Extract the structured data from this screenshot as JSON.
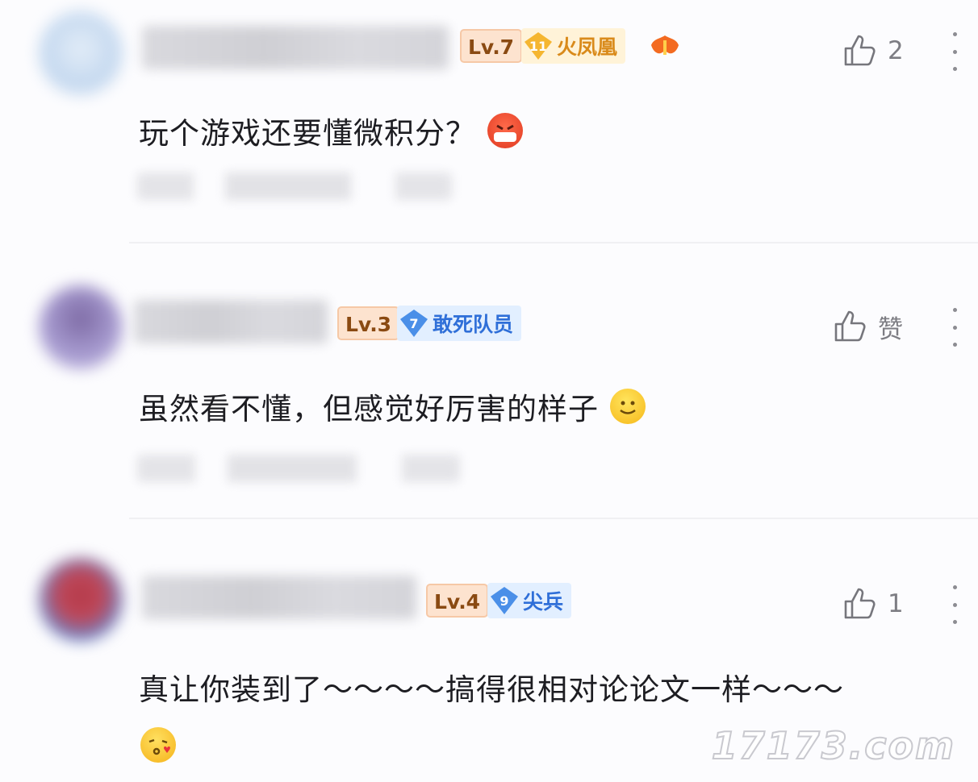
{
  "comments": [
    {
      "level": "Lv.7",
      "rank_number": "11",
      "rank_title": "火凤凰",
      "rank_color": "#f5b630",
      "extra_badge_icon": "phoenix-icon",
      "like_icon": "thumbs-up-icon",
      "like_count": "2",
      "text": "玩个游戏还要懂微积分？",
      "emoji": "angry-mask-emoji"
    },
    {
      "level": "Lv.3",
      "rank_number": "7",
      "rank_title": "敢死队员",
      "rank_color": "#4a8fe8",
      "like_icon": "thumbs-up-icon",
      "like_count": "赞",
      "text": "虽然看不懂，但感觉好厉害的样子",
      "emoji": "smile-emoji"
    },
    {
      "level": "Lv.4",
      "rank_number": "9",
      "rank_title": "尖兵",
      "rank_color": "#4a8fe8",
      "like_icon": "thumbs-up-icon",
      "like_count": "1",
      "text": "真让你装到了～～～～搞得很相对论论文一样～～～",
      "emoji": "kiss-emoji"
    }
  ],
  "watermark": "17173.com"
}
